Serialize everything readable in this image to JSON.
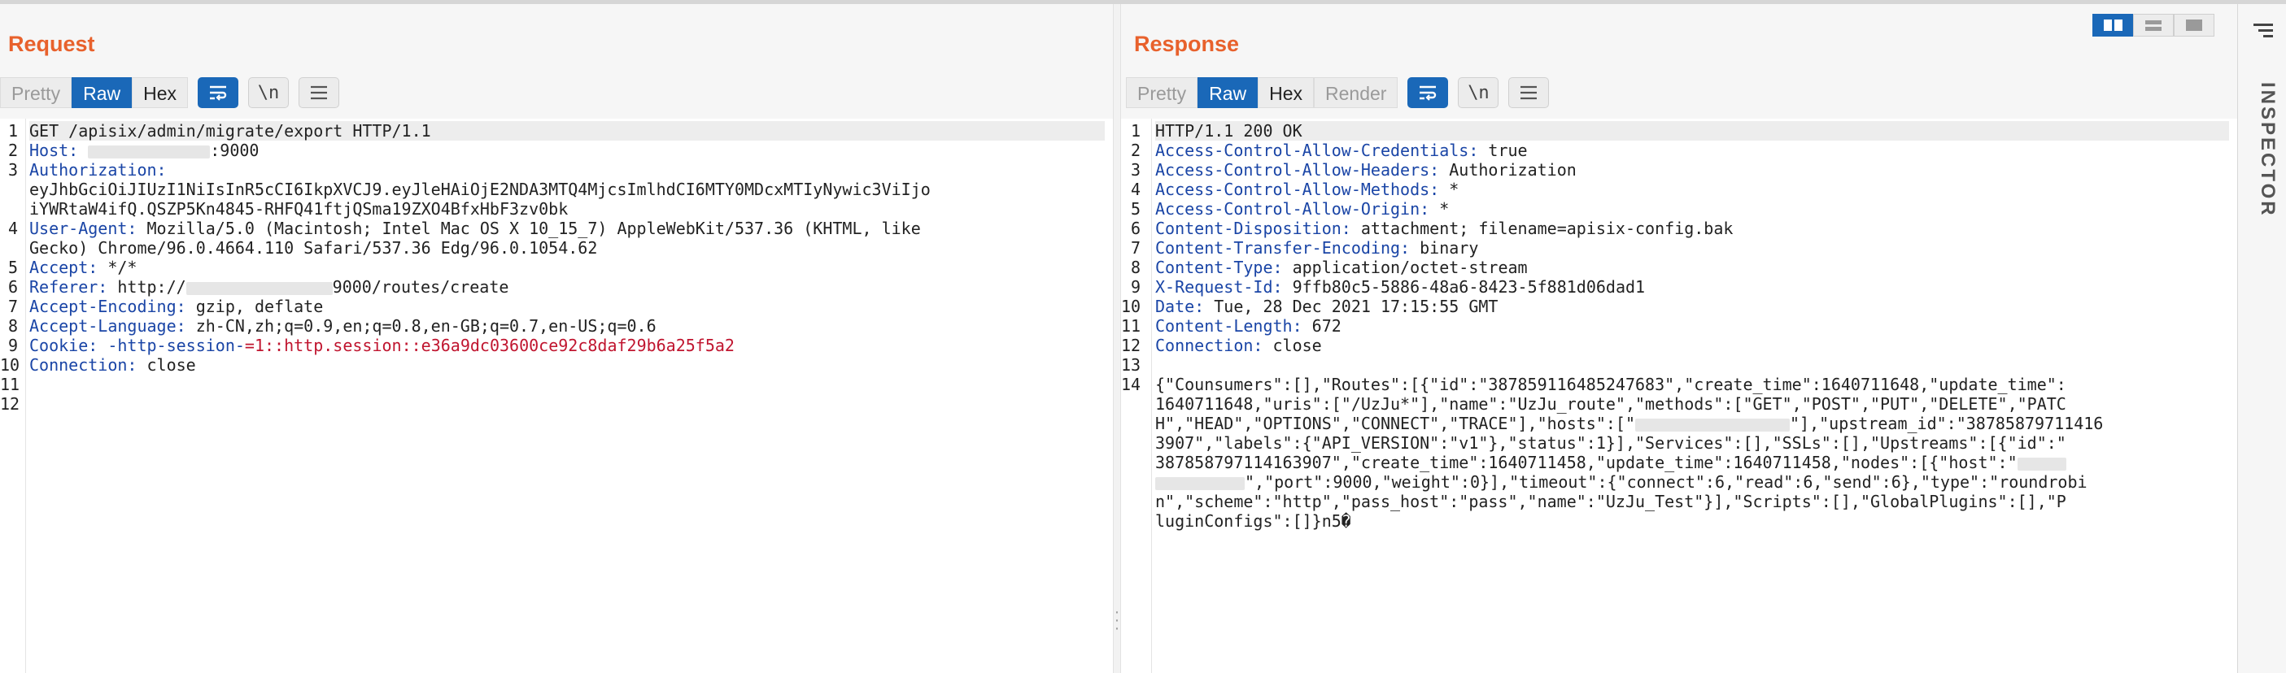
{
  "request": {
    "title": "Request",
    "tabs": [
      "Pretty",
      "Raw",
      "Hex"
    ],
    "active_tab": "Raw",
    "tools": {
      "newline_label": "\\n"
    },
    "line_numbers": [
      "1",
      "2",
      "3",
      "",
      "4",
      "",
      "5",
      "6",
      "7",
      "8",
      "9",
      "10",
      "11",
      "12"
    ],
    "lines": {
      "l1": "GET /apisix/admin/migrate/export HTTP/1.1",
      "l2_key": "Host:",
      "l2_val": ":9000",
      "l3_key": "Authorization:",
      "l3_cont1": "eyJhbGciOiJIUzI1NiIsInR5cCI6IkpXVCJ9.eyJleHAiOjE2NDA3MTQ4MjcsImlhdCI6MTY0MDcxMTIyNywic3ViIjo",
      "l3_cont2": "iYWRtaW4ifQ.QSZP5Kn4845-RHFQ41ftjQSma19ZXO4BfxHbF3zv0bk",
      "l4_key": "User-Agent:",
      "l4_val": " Mozilla/5.0 (Macintosh; Intel Mac OS X 10_15_7) AppleWebKit/537.36 (KHTML, like",
      "l4_cont": "Gecko) Chrome/96.0.4664.110 Safari/537.36 Edg/96.0.1054.62",
      "l5_key": "Accept:",
      "l5_val": " */*",
      "l6_key": "Referer:",
      "l6_val_a": " http://",
      "l6_val_b": "9000/routes/create",
      "l7_key": "Accept-Encoding:",
      "l7_val": " gzip, deflate",
      "l8_key": "Accept-Language:",
      "l8_val": " zh-CN,zh;q=0.9,en;q=0.8,en-GB;q=0.7,en-US;q=0.6",
      "l9_key": "Cookie:",
      "l9_name": " -http-session-",
      "l9_val": "=1::http.session::e36a9dc03600ce92c8daf29b6a25f5a2",
      "l10_key": "Connection:",
      "l10_val": " close"
    }
  },
  "response": {
    "title": "Response",
    "tabs": [
      "Pretty",
      "Raw",
      "Hex",
      "Render"
    ],
    "active_tab": "Raw",
    "tools": {
      "newline_label": "\\n"
    },
    "line_numbers": [
      "1",
      "2",
      "3",
      "4",
      "5",
      "6",
      "7",
      "8",
      "9",
      "10",
      "11",
      "12",
      "13",
      "14"
    ],
    "lines": {
      "l1": "HTTP/1.1 200 OK",
      "l2_key": "Access-Control-Allow-Credentials:",
      "l2_val": " true",
      "l3_key": "Access-Control-Allow-Headers:",
      "l3_val": " Authorization",
      "l4_key": "Access-Control-Allow-Methods:",
      "l4_val": " *",
      "l5_key": "Access-Control-Allow-Origin:",
      "l5_val": " *",
      "l6_key": "Content-Disposition:",
      "l6_val": " attachment; filename=apisix-config.bak",
      "l7_key": "Content-Transfer-Encoding:",
      "l7_val": " binary",
      "l8_key": "Content-Type:",
      "l8_val": " application/octet-stream",
      "l9_key": "X-Request-Id:",
      "l9_val": " 9ffb80c5-5886-48a6-8423-5f881d06dad1",
      "l10_key": "Date:",
      "l10_val": " Tue, 28 Dec 2021 17:15:55 GMT",
      "l11_key": "Content-Length:",
      "l11_val": " 672",
      "l12_key": "Connection:",
      "l12_val": " close",
      "body_1": "{\"Counsumers\":[],\"Routes\":[{\"id\":\"387859116485247683\",\"create_time\":1640711648,\"update_time\":",
      "body_2": "1640711648,\"uris\":[\"/UzJu*\"],\"name\":\"UzJu_route\",\"methods\":[\"GET\",\"POST\",\"PUT\",\"DELETE\",\"PATC",
      "body_3a": "H\",\"HEAD\",\"OPTIONS\",\"CONNECT\",\"TRACE\"],\"hosts\":[\"",
      "body_3b": "\"],\"upstream_id\":\"38785879711416",
      "body_4": "3907\",\"labels\":{\"API_VERSION\":\"v1\"},\"status\":1}],\"Services\":[],\"SSLs\":[],\"Upstreams\":[{\"id\":\"",
      "body_5": "387858797114163907\",\"create_time\":1640711458,\"update_time\":1640711458,\"nodes\":[{\"host\":\"",
      "body_6": "\",\"port\":9000,\"weight\":0}],\"timeout\":{\"connect\":6,\"read\":6,\"send\":6},\"type\":\"roundrobi",
      "body_7": "n\",\"scheme\":\"http\",\"pass_host\":\"pass\",\"name\":\"UzJu_Test\"}],\"Scripts\":[],\"GlobalPlugins\":[],\"P",
      "body_8": "luginConfigs\":[]}n5�"
    }
  },
  "inspector": {
    "label": "INSPECTOR"
  },
  "colors": {
    "accent": "#e8612c",
    "active": "#1a68b8",
    "header_key": "#1a45a6",
    "cookie": "#c0152f"
  }
}
